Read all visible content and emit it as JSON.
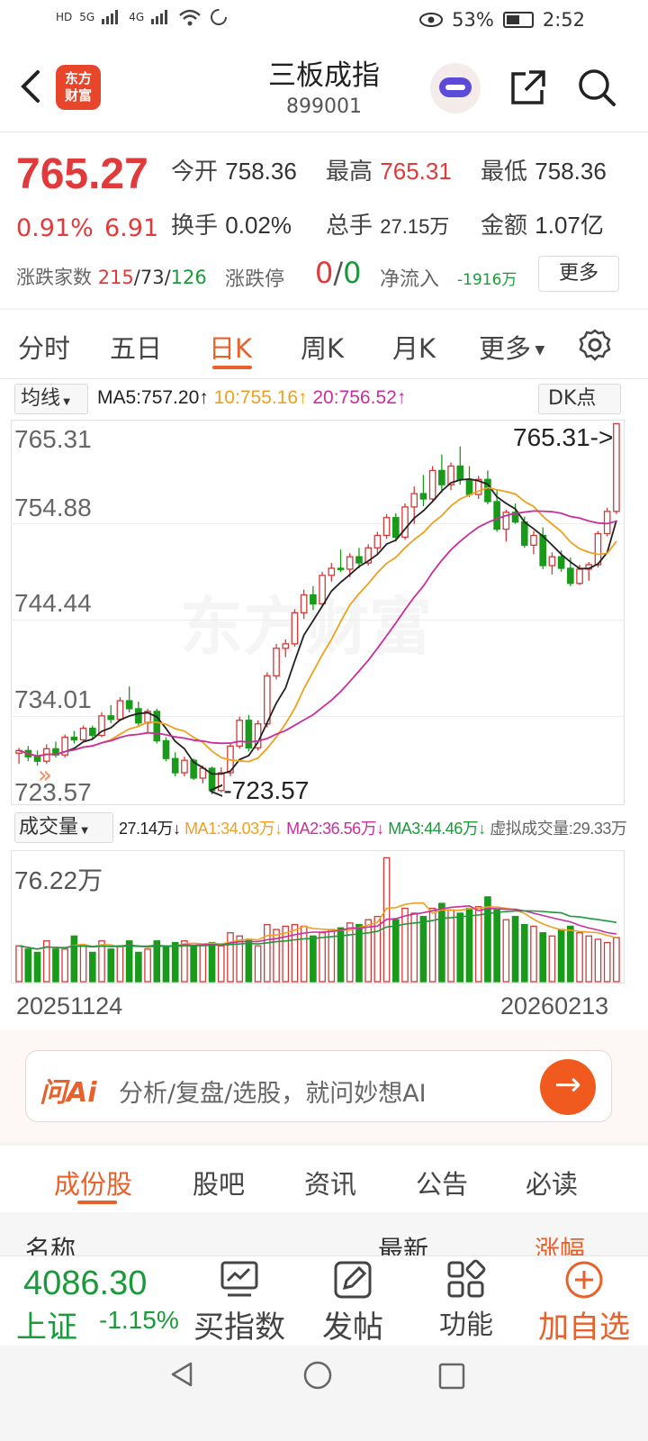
{
  "status": {
    "battery": "53%",
    "time": "2:52",
    "signal_left": "HD",
    "net1": "5G",
    "net2": "4G"
  },
  "header": {
    "title": "三板成指",
    "code": "899001",
    "logo_text": "东方财富"
  },
  "quote": {
    "price": "765.27",
    "pct": "0.91%",
    "change": "6.91",
    "open_label": "今开",
    "open": "758.36",
    "high_label": "最高",
    "high": "765.31",
    "low_label": "最低",
    "low": "758.36",
    "turnover_label": "换手",
    "turnover": "0.02%",
    "volume_label": "总手",
    "volume": "27.15万",
    "amount_label": "金额",
    "amount": "1.07亿",
    "breadth_label": "涨跌家数",
    "up": "215",
    "flat": "73",
    "down": "126",
    "limit_label": "涨跌停",
    "limit_up": "0",
    "limit_down": "0",
    "netflow_label": "净流入",
    "netflow": "-1916万",
    "more_button": "更多"
  },
  "tabs": [
    "分时",
    "五日",
    "日K",
    "周K",
    "月K",
    "更多"
  ],
  "active_tab": "日K",
  "ma_row": {
    "selector": "均线",
    "ma5": "MA5:757.20",
    "ma10": "10:755.16",
    "ma20": "20:756.52",
    "dk_button": "DK点",
    "colors": {
      "ma5": "#222222",
      "ma10": "#f0a020",
      "ma20": "#c72f9c"
    }
  },
  "vol_row": {
    "selector": "成交量",
    "vol": "27.14万",
    "ma1": "MA1:34.03万",
    "ma2": "MA2:36.56万",
    "ma3": "MA3:44.46万",
    "virtual": "虚拟成交量:29.33万",
    "colors": {
      "ma1": "#f0a020",
      "ma2": "#c72f9c",
      "ma3": "#1a9a3b"
    }
  },
  "chart_data": {
    "type": "candlestick",
    "y_ticks": [
      "765.31",
      "754.88",
      "744.44",
      "734.01",
      "723.57"
    ],
    "ylim": [
      723.57,
      765.31
    ],
    "max_label": "765.31->",
    "min_label": "<-723.57",
    "vol_max_label": "76.22万",
    "vol_ylim": [
      0,
      76.22
    ],
    "x_start": "20251124",
    "x_end": "20260213",
    "up_color": "#d23a3a",
    "down_color": "#1a9a1a",
    "candles": [
      [
        728.2,
        728.8,
        727.0,
        728.5,
        22
      ],
      [
        728.5,
        729.0,
        727.3,
        727.8,
        20
      ],
      [
        727.8,
        728.5,
        726.8,
        727.3,
        18
      ],
      [
        727.3,
        729.2,
        727.0,
        728.7,
        25
      ],
      [
        728.7,
        729.5,
        727.7,
        728.0,
        20
      ],
      [
        728.0,
        730.3,
        727.7,
        730.0,
        20
      ],
      [
        730.0,
        730.7,
        729.3,
        729.7,
        28
      ],
      [
        729.7,
        731.3,
        729.4,
        731.0,
        22
      ],
      [
        731.0,
        731.3,
        729.8,
        730.2,
        18
      ],
      [
        730.2,
        732.8,
        730.0,
        732.4,
        25
      ],
      [
        732.4,
        733.6,
        731.6,
        732.0,
        20
      ],
      [
        732.0,
        734.5,
        731.8,
        734.1,
        22
      ],
      [
        734.1,
        735.7,
        732.8,
        733.2,
        25
      ],
      [
        733.2,
        734.0,
        731.3,
        731.6,
        18
      ],
      [
        731.6,
        733.2,
        730.5,
        732.9,
        20
      ],
      [
        732.9,
        733.2,
        729.3,
        729.6,
        25
      ],
      [
        729.6,
        730.0,
        727.3,
        727.6,
        22
      ],
      [
        727.6,
        728.3,
        725.6,
        726.0,
        24
      ],
      [
        726.0,
        727.8,
        725.6,
        727.4,
        25
      ],
      [
        727.4,
        727.6,
        725.2,
        725.4,
        22
      ],
      [
        725.4,
        726.8,
        724.8,
        726.5,
        23
      ],
      [
        726.5,
        726.7,
        723.57,
        724.0,
        24
      ],
      [
        724.0,
        726.6,
        723.8,
        726.0,
        22
      ],
      [
        726.0,
        729.4,
        725.6,
        729.0,
        30
      ],
      [
        729.0,
        732.3,
        728.7,
        731.9,
        28
      ],
      [
        731.9,
        732.5,
        728.4,
        728.8,
        26
      ],
      [
        728.8,
        731.9,
        728.5,
        731.5,
        22
      ],
      [
        731.5,
        737.3,
        731.1,
        736.9,
        35
      ],
      [
        736.9,
        740.5,
        736.5,
        740.0,
        32
      ],
      [
        740.0,
        741.0,
        739.0,
        740.5,
        34
      ],
      [
        740.5,
        744.4,
        740.2,
        744.0,
        35
      ],
      [
        744.0,
        746.6,
        743.3,
        746.0,
        34
      ],
      [
        746.0,
        747.0,
        744.3,
        745.0,
        28
      ],
      [
        745.0,
        748.6,
        744.7,
        748.2,
        30
      ],
      [
        748.2,
        749.6,
        747.5,
        749.0,
        32
      ],
      [
        749.0,
        751.1,
        748.6,
        748.9,
        33
      ],
      [
        748.9,
        750.7,
        748.0,
        750.3,
        36
      ],
      [
        750.3,
        751.3,
        749.0,
        749.6,
        35
      ],
      [
        749.6,
        751.7,
        749.3,
        751.3,
        38
      ],
      [
        751.3,
        753.1,
        750.5,
        752.7,
        40
      ],
      [
        752.7,
        755.1,
        752.3,
        754.7,
        76
      ],
      [
        754.7,
        755.2,
        752.0,
        752.5,
        38
      ],
      [
        752.5,
        756.3,
        752.2,
        755.9,
        45
      ],
      [
        755.9,
        758.2,
        754.0,
        757.4,
        42
      ],
      [
        757.4,
        759.5,
        756.0,
        756.8,
        40
      ],
      [
        756.8,
        760.5,
        756.5,
        760.0,
        45
      ],
      [
        760.0,
        761.8,
        757.5,
        758.4,
        48
      ],
      [
        758.4,
        760.9,
        757.8,
        760.5,
        44
      ],
      [
        760.5,
        762.7,
        758.4,
        759.0,
        42
      ],
      [
        759.0,
        760.5,
        757.0,
        757.3,
        45
      ],
      [
        757.3,
        759.4,
        756.8,
        759.0,
        46
      ],
      [
        759.0,
        760.0,
        756.2,
        756.5,
        52
      ],
      [
        756.5,
        757.8,
        753.1,
        753.4,
        44
      ],
      [
        753.4,
        755.6,
        752.0,
        755.3,
        38
      ],
      [
        755.3,
        756.3,
        754.0,
        754.2,
        40
      ],
      [
        754.2,
        754.8,
        751.3,
        751.6,
        35
      ],
      [
        751.6,
        753.2,
        750.6,
        752.7,
        34
      ],
      [
        752.7,
        753.6,
        748.9,
        749.3,
        30
      ],
      [
        749.3,
        750.8,
        748.3,
        750.3,
        28
      ],
      [
        750.3,
        751.0,
        748.6,
        749.0,
        32
      ],
      [
        749.0,
        750.2,
        747.0,
        747.3,
        34
      ],
      [
        747.3,
        749.4,
        747.1,
        748.9,
        30
      ],
      [
        748.9,
        749.7,
        747.6,
        749.4,
        28
      ],
      [
        749.4,
        753.2,
        749.1,
        752.9,
        26
      ],
      [
        752.9,
        755.8,
        752.6,
        755.4,
        24
      ],
      [
        755.4,
        765.31,
        755.1,
        765.27,
        27
      ]
    ]
  },
  "ai_bar": {
    "logo": "问Ai",
    "placeholder": "分析/复盘/选股，就问妙想AI",
    "go": "→"
  },
  "bottom_tabs": [
    "成份股",
    "股吧",
    "资讯",
    "公告",
    "必读"
  ],
  "active_bottom_tab": "成份股",
  "list_header": {
    "name": "名称",
    "latest": "最新",
    "change": "涨幅"
  },
  "bottom_bar": {
    "index_price": "4086.30",
    "index_name": "上证",
    "index_pct": "-1.15%",
    "actions": [
      "买指数",
      "发帖",
      "功能",
      "加自选"
    ]
  }
}
